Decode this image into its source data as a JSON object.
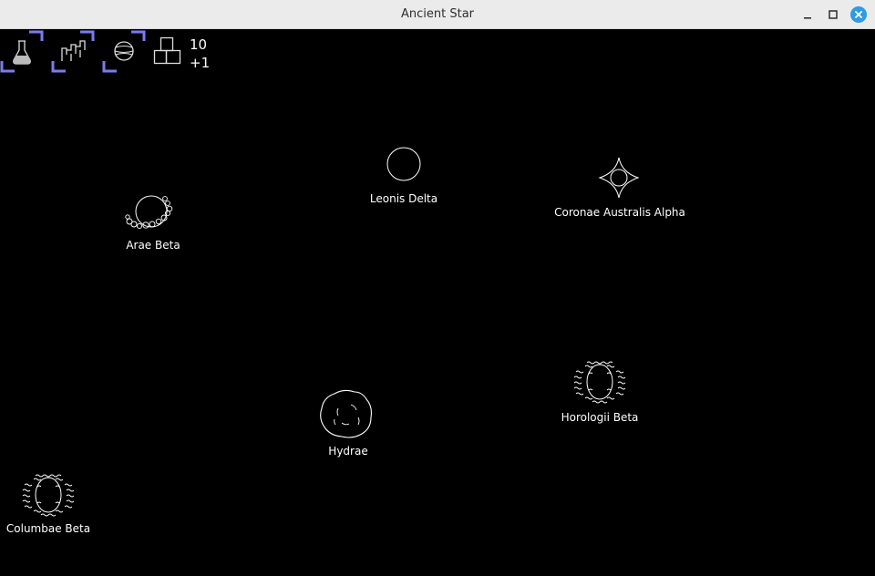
{
  "window": {
    "title": "Ancient Star",
    "controls": [
      "minimize-icon",
      "maximize-icon",
      "close-icon"
    ]
  },
  "toolbar": {
    "tools": [
      {
        "name": "research",
        "icon": "flask-icon"
      },
      {
        "name": "build",
        "icon": "factory-icon"
      },
      {
        "name": "planets",
        "icon": "planet-icon"
      }
    ],
    "resource": {
      "icon": "stacked-blocks-icon",
      "amount": "10",
      "rate": "+1"
    },
    "accent_color": "#7b7bf0"
  },
  "stars": [
    {
      "name": "Leonis Delta",
      "icon": "plain-star-icon"
    },
    {
      "name": "Coronae Australis Alpha",
      "icon": "spiky-star-icon"
    },
    {
      "name": "Arae Beta",
      "icon": "ringed-star-icon"
    },
    {
      "name": "Horologii Beta",
      "icon": "wavy-star-icon"
    },
    {
      "name": "Hydrae",
      "icon": "lumpy-star-icon"
    },
    {
      "name": "Columbae Beta",
      "icon": "wavy-star-icon"
    }
  ]
}
